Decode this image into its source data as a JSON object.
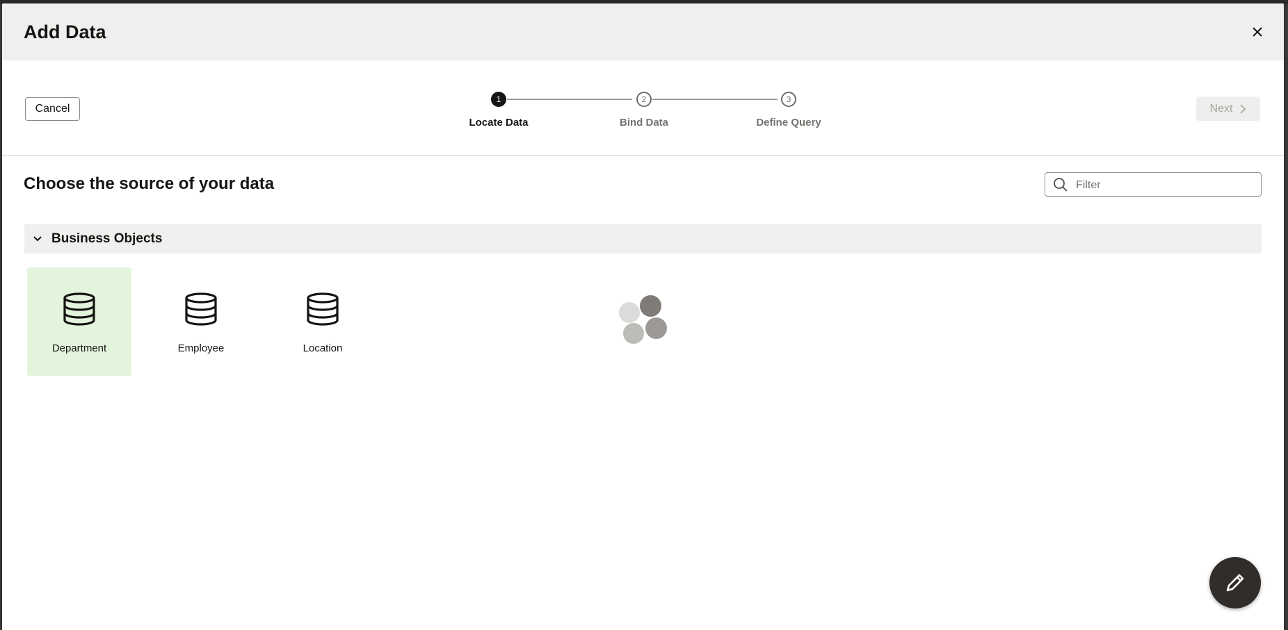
{
  "dialog": {
    "title": "Add Data",
    "close_icon": "close-icon"
  },
  "toolbar": {
    "cancel_label": "Cancel",
    "next_label": "Next",
    "next_icon": "chevron-right-icon"
  },
  "train": {
    "steps": [
      {
        "number": "1",
        "label": "Locate Data",
        "state": "active"
      },
      {
        "number": "2",
        "label": "Bind Data",
        "state": "inactive"
      },
      {
        "number": "3",
        "label": "Define Query",
        "state": "inactive"
      }
    ]
  },
  "main": {
    "heading": "Choose the source of your data",
    "filter": {
      "placeholder": "Filter",
      "value": "",
      "icon": "search-icon"
    },
    "group": {
      "label": "Business Objects",
      "expanded": true,
      "items": [
        {
          "label": "Department",
          "icon": "database-icon",
          "selected": true
        },
        {
          "label": "Employee",
          "icon": "database-icon",
          "selected": false
        },
        {
          "label": "Location",
          "icon": "database-icon",
          "selected": false
        }
      ]
    }
  },
  "loading_indicator": "loading-spinner",
  "fab_icon": "pencil-icon",
  "colors": {
    "header_bg": "#f1efed",
    "selected_tile_bg": "#e3f4dc",
    "active_step": "#161513",
    "fab_bg": "#312d2a"
  }
}
